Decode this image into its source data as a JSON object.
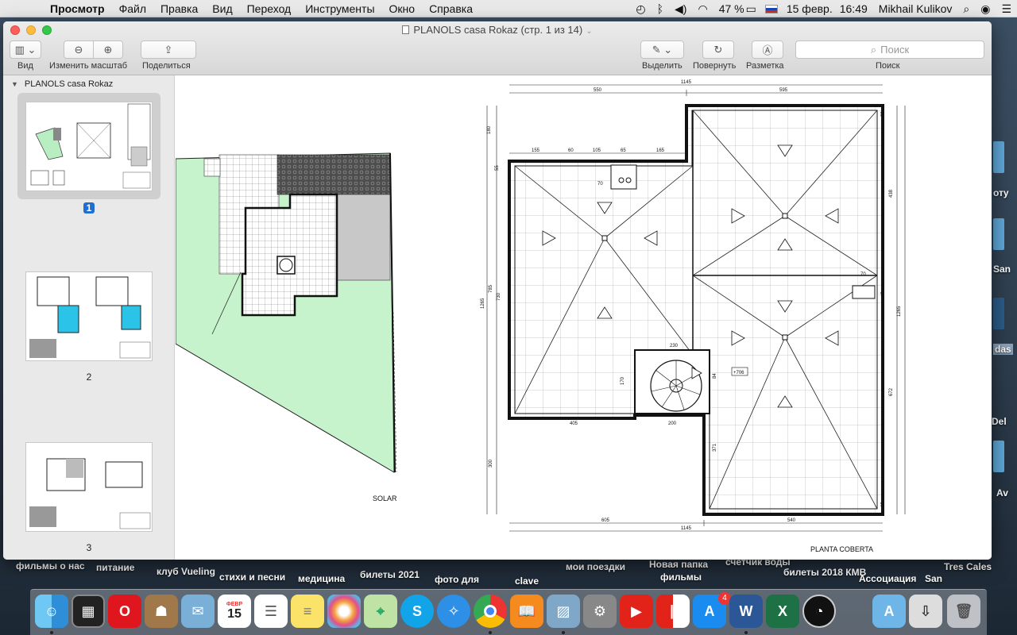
{
  "menubar": {
    "app": "Просмотр",
    "items": [
      "Файл",
      "Правка",
      "Вид",
      "Переход",
      "Инструменты",
      "Окно",
      "Справка"
    ],
    "battery": "47 %",
    "date": "15 февр.",
    "time": "16:49",
    "user": "Mikhail Kulikov"
  },
  "window": {
    "title": "PLANOLS casa Rokaz (стр. 1 из 14)",
    "toolbar": {
      "view_label": "Вид",
      "zoom_label": "Изменить масштаб",
      "share_label": "Поделиться",
      "highlight_label": "Выделить",
      "rotate_label": "Повернуть",
      "markup_label": "Разметка",
      "search_placeholder": "Поиск",
      "search_label": "Поиск"
    }
  },
  "sidebar": {
    "document": "PLANOLS casa Rokaz",
    "pages": [
      "1",
      "2",
      "3"
    ],
    "selected_page": "1"
  },
  "document": {
    "left_caption": "SOLAR",
    "right_caption": "PLANTA COBERTA",
    "dim_top_total": "1145",
    "dim_top_left": "550",
    "dim_top_right": "595",
    "dim_row": [
      "155",
      "60",
      "105",
      "65",
      "165"
    ],
    "dim_left": [
      "180",
      "55",
      "1265",
      "785",
      "730",
      "170",
      "300"
    ],
    "dim_right": [
      "55",
      "438",
      "45",
      "1265",
      "672",
      "65"
    ],
    "dim_mid": [
      "70",
      "70",
      "230",
      "84",
      "405",
      "200",
      "371"
    ],
    "dim_bottom": [
      "605",
      "540",
      "1145"
    ],
    "tag": "+706"
  },
  "desktop": {
    "labels": [
      "фильмы о нас",
      "питание",
      "клуб Vueling",
      "стихи и песни",
      "медицина",
      "билеты 2021",
      "фото для",
      "clave",
      "мои поездки",
      "Новая папка",
      "фильмы",
      "счетчик воды",
      "билеты 2018 КМВ",
      "Ассоциация",
      "San",
      "Tres Cales",
      "Av",
      "отy",
      "San",
      "das",
      "Del"
    ]
  },
  "dock": {
    "calendar_month": "ФЕВР",
    "calendar_day": "15",
    "appstore_badge": "4"
  },
  "colors": {
    "accent": "#1f6fd0",
    "garden": "#c6f2cc",
    "dark_paving": "#555555"
  }
}
